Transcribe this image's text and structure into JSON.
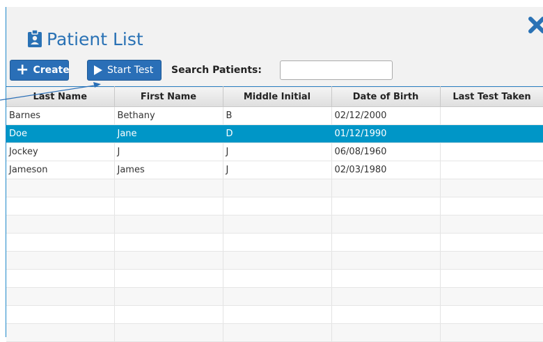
{
  "dialog": {
    "title": "Patient List",
    "title_icon": "clipboard-id-icon",
    "close_icon": "close-icon"
  },
  "toolbar": {
    "create_label": "Create",
    "start_test_label": "Start Test",
    "search_label": "Search Patients:",
    "search_value": "",
    "search_placeholder": ""
  },
  "table": {
    "columns": [
      "Last Name",
      "First Name",
      "Middle Initial",
      "Date of Birth",
      "Last Test Taken"
    ],
    "selected_row": 1,
    "rows": [
      [
        "Barnes",
        "Bethany",
        "B",
        "02/12/2000",
        ""
      ],
      [
        "Doe",
        "Jane",
        "D",
        "01/12/1990",
        ""
      ],
      [
        "Jockey",
        "J",
        "J",
        "06/08/1960",
        ""
      ],
      [
        "Jameson",
        "James",
        "J",
        "02/03/1980",
        ""
      ]
    ]
  },
  "colors": {
    "accent": "#2a6fb7",
    "selected_row": "#0096c7",
    "title": "#2a72b5"
  }
}
